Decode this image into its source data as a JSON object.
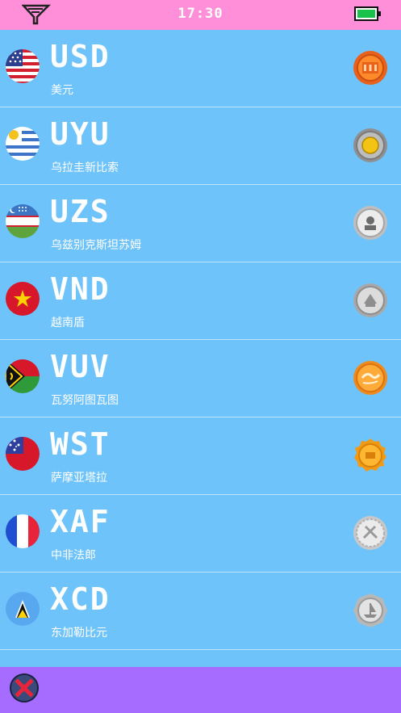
{
  "status": {
    "time": "17:30",
    "signal_icon": "signal-icon",
    "battery_icon": "battery-icon",
    "battery_color": "#19c24a"
  },
  "currencies": [
    {
      "code": "USD",
      "name": "美元",
      "flag": "us-flag-icon",
      "coin_color": "#ff7a1a"
    },
    {
      "code": "UYU",
      "name": "乌拉圭新比索",
      "flag": "uruguay-flag-icon",
      "coin_color": "#b9b9b9"
    },
    {
      "code": "UZS",
      "name": "乌兹别克斯坦苏姆",
      "flag": "uzbekistan-flag-icon",
      "coin_color": "#e6e6e6"
    },
    {
      "code": "VND",
      "name": "越南盾",
      "flag": "vietnam-flag-icon",
      "coin_color": "#d6d6d6"
    },
    {
      "code": "VUV",
      "name": "瓦努阿图瓦图",
      "flag": "vanuatu-flag-icon",
      "coin_color": "#ffa531"
    },
    {
      "code": "WST",
      "name": "萨摩亚塔拉",
      "flag": "samoa-flag-icon",
      "coin_color": "#ffab25"
    },
    {
      "code": "XAF",
      "name": "中非法郎",
      "flag": "france-flag-icon",
      "coin_color": "#dedede"
    },
    {
      "code": "XCD",
      "name": "东加勒比元",
      "flag": "saint-lucia-flag-icon",
      "coin_color": "#cfcfcf"
    }
  ],
  "colors": {
    "status_bar": "#ff8fd8",
    "list_bg": "#6ec3fb",
    "bottom_bar": "#a66bff",
    "close_icon": "#e8243b"
  },
  "bottom": {
    "close_icon": "close-icon"
  }
}
